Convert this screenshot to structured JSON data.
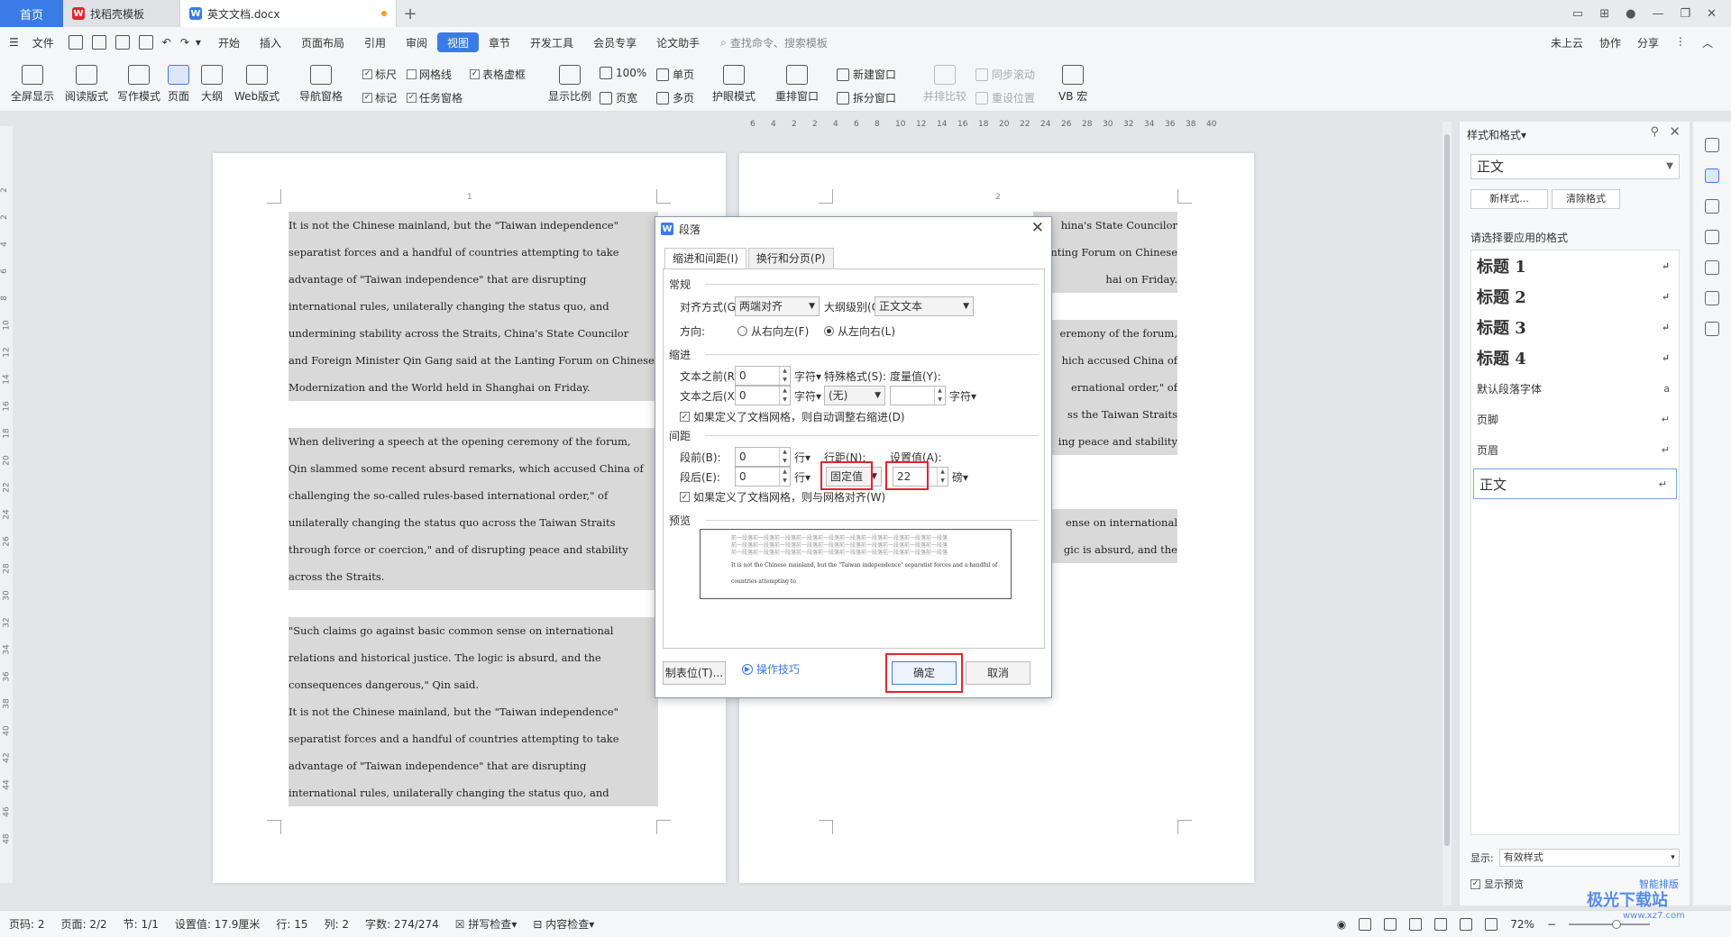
{
  "tabs": {
    "home": "首页",
    "template": "找稻壳模板",
    "doc": "英文文档.docx"
  },
  "menu": {
    "file": "文件",
    "items": [
      "开始",
      "插入",
      "页面布局",
      "引用",
      "审阅",
      "视图",
      "章节",
      "开发工具",
      "会员专享",
      "论文助手"
    ],
    "active": "视图",
    "search": "查找命令、搜索模板",
    "right": [
      "未上云",
      "协作",
      "分享"
    ]
  },
  "ribbon": {
    "fullscreen": "全屏显示",
    "reading": "阅读版式",
    "writing": "写作模式",
    "page": "页面",
    "outline": "大纲",
    "web": "Web版式",
    "nav": "导航窗格",
    "ruler": "标尺",
    "grid": "网格线",
    "table_grid": "表格虚框",
    "mark": "标记",
    "task_pane": "任务窗格",
    "zoom": "显示比例",
    "hundred": "100%",
    "page_width": "页宽",
    "single": "单页",
    "multi": "多页",
    "eye": "护眼模式",
    "rearrange": "重排窗口",
    "new_window": "新建窗口",
    "split": "拆分窗口",
    "side_by_side": "并排比较",
    "sync_scroll": "同步滚动",
    "reset_pos": "重设位置",
    "vb": "VB 宏"
  },
  "ruler_numbers": [
    "6",
    "4",
    "2",
    "2",
    "4",
    "6",
    "8",
    "10",
    "12",
    "14",
    "16",
    "18",
    "20",
    "22",
    "24",
    "26",
    "28",
    "30",
    "32",
    "34",
    "36",
    "38",
    "40"
  ],
  "vruler_numbers": [
    "2",
    "2",
    "4",
    "6",
    "8",
    "10",
    "12",
    "14",
    "16",
    "18",
    "20",
    "22",
    "24",
    "26",
    "28",
    "30",
    "32",
    "34",
    "36",
    "38",
    "40",
    "42",
    "44",
    "46",
    "48"
  ],
  "page1": {
    "num": "1",
    "lines": [
      "It is not the Chinese mainland, but the \"Taiwan independence\"",
      "separatist forces and a handful of countries attempting to take",
      "advantage  of  \"Taiwan  independence\"  that  are  disrupting",
      "international rules, unilaterally changing the status quo, and",
      "undermining stability across the Straits, China's State Councilor",
      "and Foreign Minister Qin Gang said at the Lanting Forum on Chinese",
      "Modernization and the World held in Shanghai on Friday.",
      "",
      "When delivering a speech at the opening ceremony of the forum,",
      "Qin slammed some recent absurd remarks, which accused China of",
      "challenging the so-called rules-based international order,\" of",
      "unilaterally changing the status quo across the Taiwan Straits",
      "through force or coercion,\" and of disrupting peace and stability",
      "across the Straits.",
      "",
      "\"Such claims go against basic common sense on international",
      "relations and historical justice. The logic is absurd, and the",
      "consequences dangerous,\" Qin said.",
      "It is not the Chinese mainland, but the \"Taiwan independence\"",
      "separatist forces and a handful of countries attempting to take",
      "advantage  of  \"Taiwan  independence\"  that  are  disrupting",
      "international rules, unilaterally changing the status quo, and"
    ]
  },
  "page2": {
    "num": "2",
    "lines": [
      "hina's State Councilor",
      "nting Forum on Chinese",
      "hai on Friday.",
      "",
      "eremony of the forum,",
      "hich accused China of",
      "ernational order,\" of",
      "ss the Taiwan Straits",
      "ing peace and stability",
      "",
      "",
      "ense on international",
      "gic is absurd, and the"
    ]
  },
  "dialog": {
    "title": "段落",
    "tab1": "缩进和间距(I)",
    "tab2": "换行和分页(P)",
    "general": "常规",
    "align_label": "对齐方式(G):",
    "align_value": "两端对齐",
    "outline_label": "大纲级别(O):",
    "outline_value": "正文文本",
    "direction_label": "方向:",
    "rtl": "从右向左(F)",
    "ltr": "从左向右(L)",
    "indent": "缩进",
    "before_text": "文本之前(R):",
    "before_val": "0",
    "after_text": "文本之后(X):",
    "after_val": "0",
    "unit_char": "字符▾",
    "special_label": "特殊格式(S):",
    "special_value": "(无)",
    "measure_label": "度量值(Y):",
    "measure_val": "",
    "auto_indent": "如果定义了文档网格，则自动调整右缩进(D)",
    "spacing": "间距",
    "before_para": "段前(B):",
    "before_para_val": "0",
    "after_para": "段后(E):",
    "after_para_val": "0",
    "unit_line": "行▾",
    "line_spacing_label": "行距(N):",
    "line_spacing_value": "固定值",
    "set_value_label": "设置值(A):",
    "set_value": "22",
    "unit_pt": "磅▾",
    "grid_align": "如果定义了文档网格，则与网格对齐(W)",
    "preview": "预览",
    "preview_text_top": "前一段落前一段落前一段落前一段落前一段落前一段落前一段落前一段落前一段落前一段落",
    "preview_text": "It is not the Chinese mainland, but the \"Taiwan independence\" separatist forces and a handful of",
    "preview_text2": "countries attempting to",
    "tabs_btn": "制表位(T)...",
    "tips": "操作技巧",
    "ok": "确定",
    "cancel": "取消"
  },
  "pane": {
    "title": "样式和格式▾",
    "current": "正文",
    "new_style": "新样式...",
    "clear": "清除格式",
    "choose": "请选择要应用的格式",
    "styles": [
      {
        "name": "标题  1",
        "kind": "h"
      },
      {
        "name": "标题  2",
        "kind": "h"
      },
      {
        "name": "标题  3",
        "kind": "h"
      },
      {
        "name": "标题  4",
        "kind": "h"
      },
      {
        "name": "默认段落字体",
        "kind": "n"
      },
      {
        "name": "页脚",
        "kind": "n"
      },
      {
        "name": "页眉",
        "kind": "n"
      },
      {
        "name": "正文",
        "kind": "cur"
      }
    ],
    "show_label": "显示:",
    "show_value": "有效样式",
    "show_preview": "显示预览",
    "smart": "智能排版"
  },
  "status": {
    "page": "页码: 2",
    "pages": "页面: 2/2",
    "section": "节: 1/1",
    "setval": "设置值: 17.9厘米",
    "row": "行: 15",
    "col": "列: 2",
    "words": "字数: 274/274",
    "spell": "拼写检查▾",
    "content": "内容检查▾",
    "zoom": "72%"
  },
  "watermark": "极光下载站",
  "watermark_url": "www.xz7.com",
  "colors": {
    "accent": "#3b7be8",
    "highlight": "#e0262d"
  }
}
